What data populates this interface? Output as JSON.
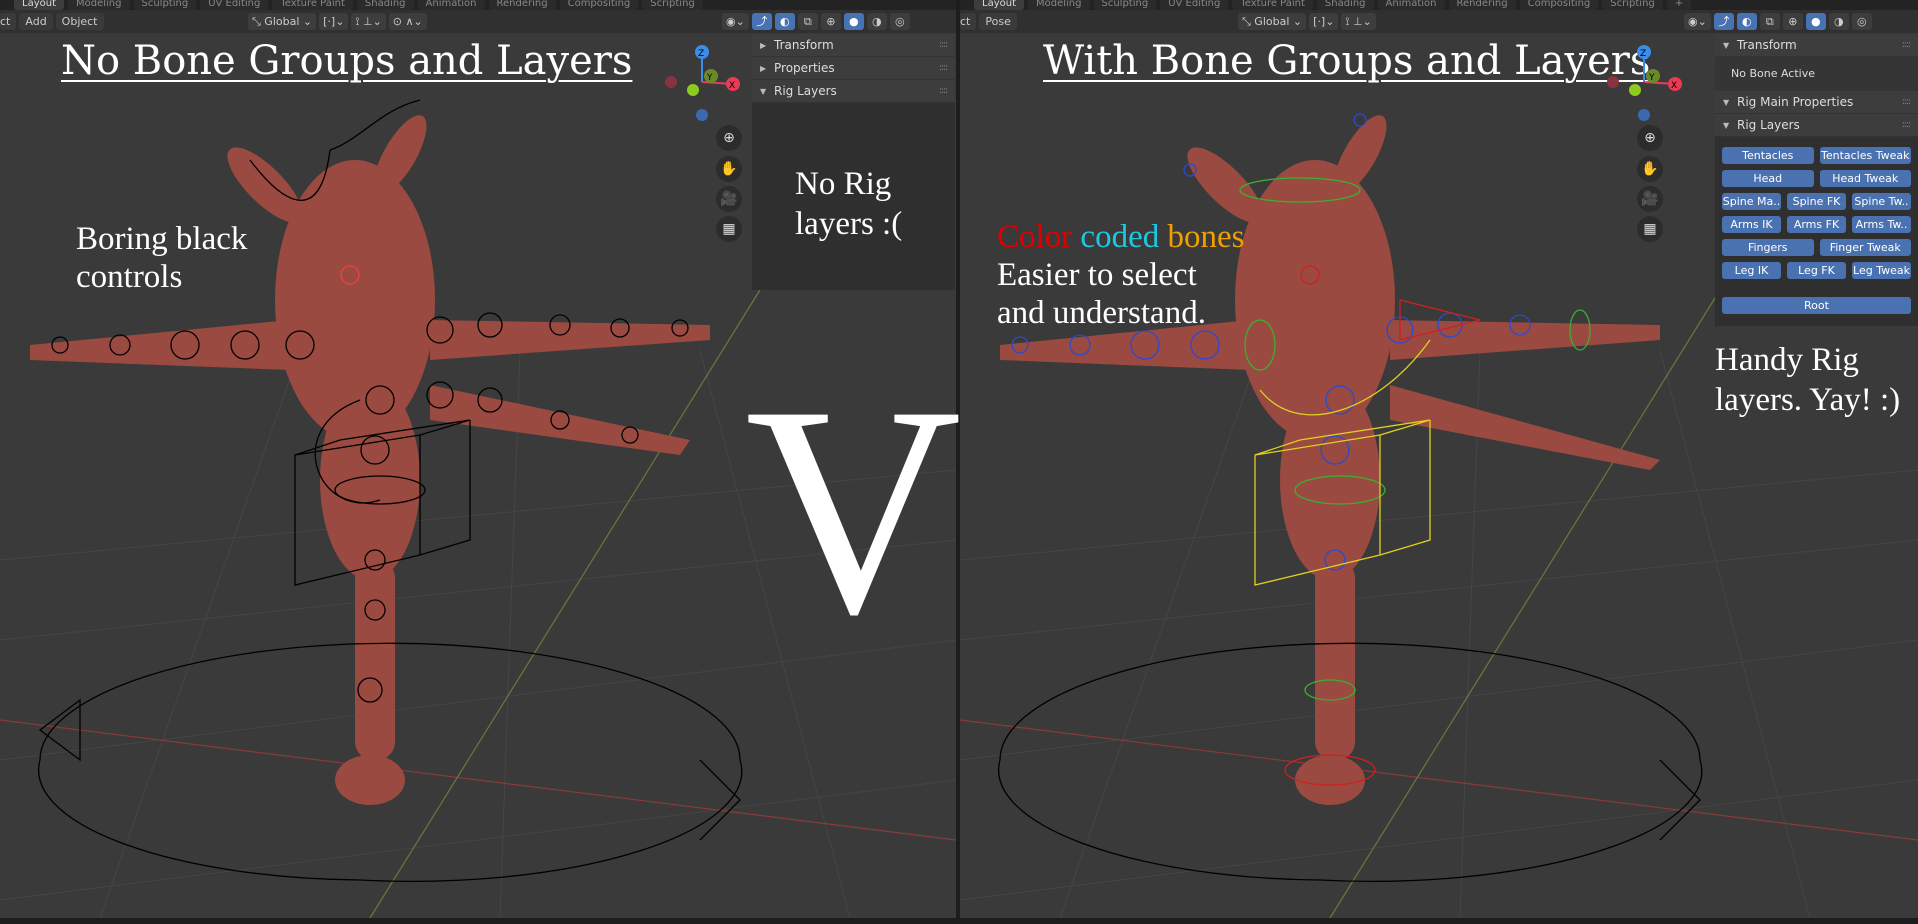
{
  "workspace_tabs": [
    "Layout",
    "Modeling",
    "Sculpting",
    "UV Editing",
    "Texture Paint",
    "Shading",
    "Animation",
    "Rendering",
    "Compositing",
    "Scripting",
    "+"
  ],
  "left": {
    "menu": [
      "ct",
      "Add",
      "Object"
    ],
    "orientation": "Global",
    "title": "No Bone Groups and Layers",
    "note": "Boring black controls",
    "panel": {
      "sections": [
        {
          "label": "Transform",
          "open": false
        },
        {
          "label": "Properties",
          "open": false
        },
        {
          "label": "Rig Layers",
          "open": true
        }
      ],
      "message": "No Rig layers :("
    },
    "bone_color": "#000000"
  },
  "right": {
    "menu": [
      "ct",
      "Pose"
    ],
    "orientation": "Global",
    "title": "With Bone Groups and Layers",
    "note": {
      "word1": "Color",
      "word2": "coded",
      "word3": "bones",
      "line2": "Easier to select",
      "line3": "and understand."
    },
    "note_colors": {
      "red": "#e00000",
      "cyan": "#1ec8e0",
      "orange": "#f0a000"
    },
    "panel": {
      "transform": "Transform",
      "transform_msg": "No Bone Active",
      "rig_main": "Rig Main Properties",
      "rig_layers": "Rig Layers",
      "rows": [
        [
          "Tentacles",
          "Tentacles Tweak"
        ],
        [
          "Head",
          "Head Tweak"
        ],
        [
          "Spine Ma..",
          "Spine FK",
          "Spine Tw.."
        ],
        [
          "Arms IK",
          "Arms FK",
          "Arms Tw.."
        ],
        [
          "Fingers",
          "Finger Tweak"
        ],
        [
          "Leg IK",
          "Leg FK",
          "Leg Tweak"
        ]
      ],
      "root": "Root"
    },
    "side_note": "Handy Rig layers. Yay! :)",
    "accent": "#4772b3"
  },
  "vs": "VS",
  "gizmo": {
    "x": "X",
    "y": "Y",
    "z": "Z"
  }
}
